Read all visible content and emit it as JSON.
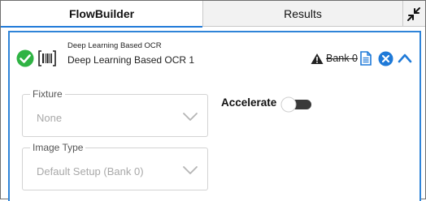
{
  "tabs": {
    "flowbuilder": "FlowBuilder",
    "results": "Results",
    "expand_icon": "collapse-arrows-icon"
  },
  "tool": {
    "type_label": "Deep Learning Based OCR",
    "name": "Deep Learning Based OCR 1",
    "status_icon": "check-circle-icon",
    "tool_icon": "barcode-ocr-icon",
    "bank_label": "Bank 0",
    "warning_icon": "warning-icon",
    "doc_icon": "document-icon",
    "close_icon": "close-circle-icon",
    "collapse_icon": "chevron-up-icon"
  },
  "fixture": {
    "label": "Fixture",
    "value": "None"
  },
  "image_type": {
    "label": "Image Type",
    "value": "Default Setup (Bank 0)"
  },
  "accelerate": {
    "label": "Accelerate",
    "enabled": false
  },
  "colors": {
    "accent": "#1f7ad8",
    "success": "#2fb344",
    "panel_border": "#2f84d8"
  }
}
